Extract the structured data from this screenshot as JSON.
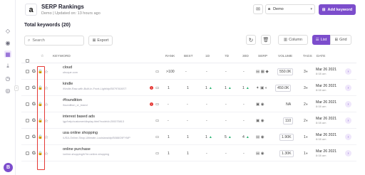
{
  "sidebar": {
    "icons": [
      "diamond-icon",
      "eye-icon",
      "grid-icon",
      "download-icon",
      "timer-icon",
      "target-icon"
    ],
    "avatar": "B"
  },
  "header": {
    "title": "SERP Rankings",
    "subtitle": "Demo | Updated on: 13 hours ago",
    "project": "Demo",
    "add_button": "Add keyword"
  },
  "toolbar": {
    "total": "Total keywords (20)",
    "search_placeholder": "Search",
    "export_label": "Export",
    "column_label": "Column",
    "list_label": "List",
    "grid_label": "Grid"
  },
  "table": {
    "headers": {
      "keyword": "KEYWORD",
      "rank": "RANK",
      "best": "BEST",
      "d1": "1D",
      "d7": "7D",
      "d30": "30D",
      "serp": "SERP",
      "volume": "VOLUME",
      "tags": "TAGS",
      "date": "DATE"
    },
    "rows": [
      {
        "keyword": "cloud",
        "url": "ubuque.com",
        "rank": ">100",
        "best": "-",
        "d1": "-",
        "d7": "-",
        "d30": "-",
        "volume": "550.0K",
        "tags": "3",
        "date": "Mar 26 2021",
        "date2": "8:08 am"
      },
      {
        "keyword": "kindle",
        "url": "/Kindle-Raw-with-Built-in-Front-Light/dp/B07978J6ST",
        "rank": "1",
        "best": "1",
        "d1": "1",
        "d7": "1",
        "d30": "1",
        "volume": "450.0K",
        "tags": "3",
        "date": "Mar 26 2021",
        "date2": "8:08 am"
      },
      {
        "keyword": "#foundition",
        "url": "/foundition_cr_brand",
        "rank": "-",
        "best": "-",
        "d1": "-",
        "d7": "-",
        "d30": "-",
        "volume": "NA",
        "tags": "2",
        "date": "Mar 26 2021",
        "date2": "8:08 am"
      },
      {
        "keyword": "interest based ads",
        "url": "/gp/help/customer/display.html?nodeId=200075813",
        "rank": "-",
        "best": "-",
        "d1": "-",
        "d7": "-",
        "d30": "-",
        "volume": "110",
        "tags": "2",
        "date": "Mar 26 2021",
        "date2": "8:08 am"
      },
      {
        "keyword": "usa online shopping",
        "url": "/USA-Online-Shop-Ultimate-Louisiana/dp/B088G9FYMP",
        "rank": "1",
        "best": "1",
        "d1": "1",
        "d7": "5",
        "d30": "4",
        "volume": "1.90K",
        "tags": "1",
        "date": "Mar 26 2021",
        "date2": "8:08 am"
      },
      {
        "keyword": "online purchase",
        "url": "/online-shopping/b?ie=online-shopping",
        "rank": "1",
        "best": "1",
        "d1": "-",
        "d7": "-",
        "d30": "-",
        "volume": "1.30K",
        "tags": "1",
        "date": "Mar 26 2021",
        "date2": "8:08 am"
      }
    ]
  },
  "colors": {
    "accent": "#7c4dcc",
    "highlight": "#e53935",
    "up": "#2bb673"
  }
}
